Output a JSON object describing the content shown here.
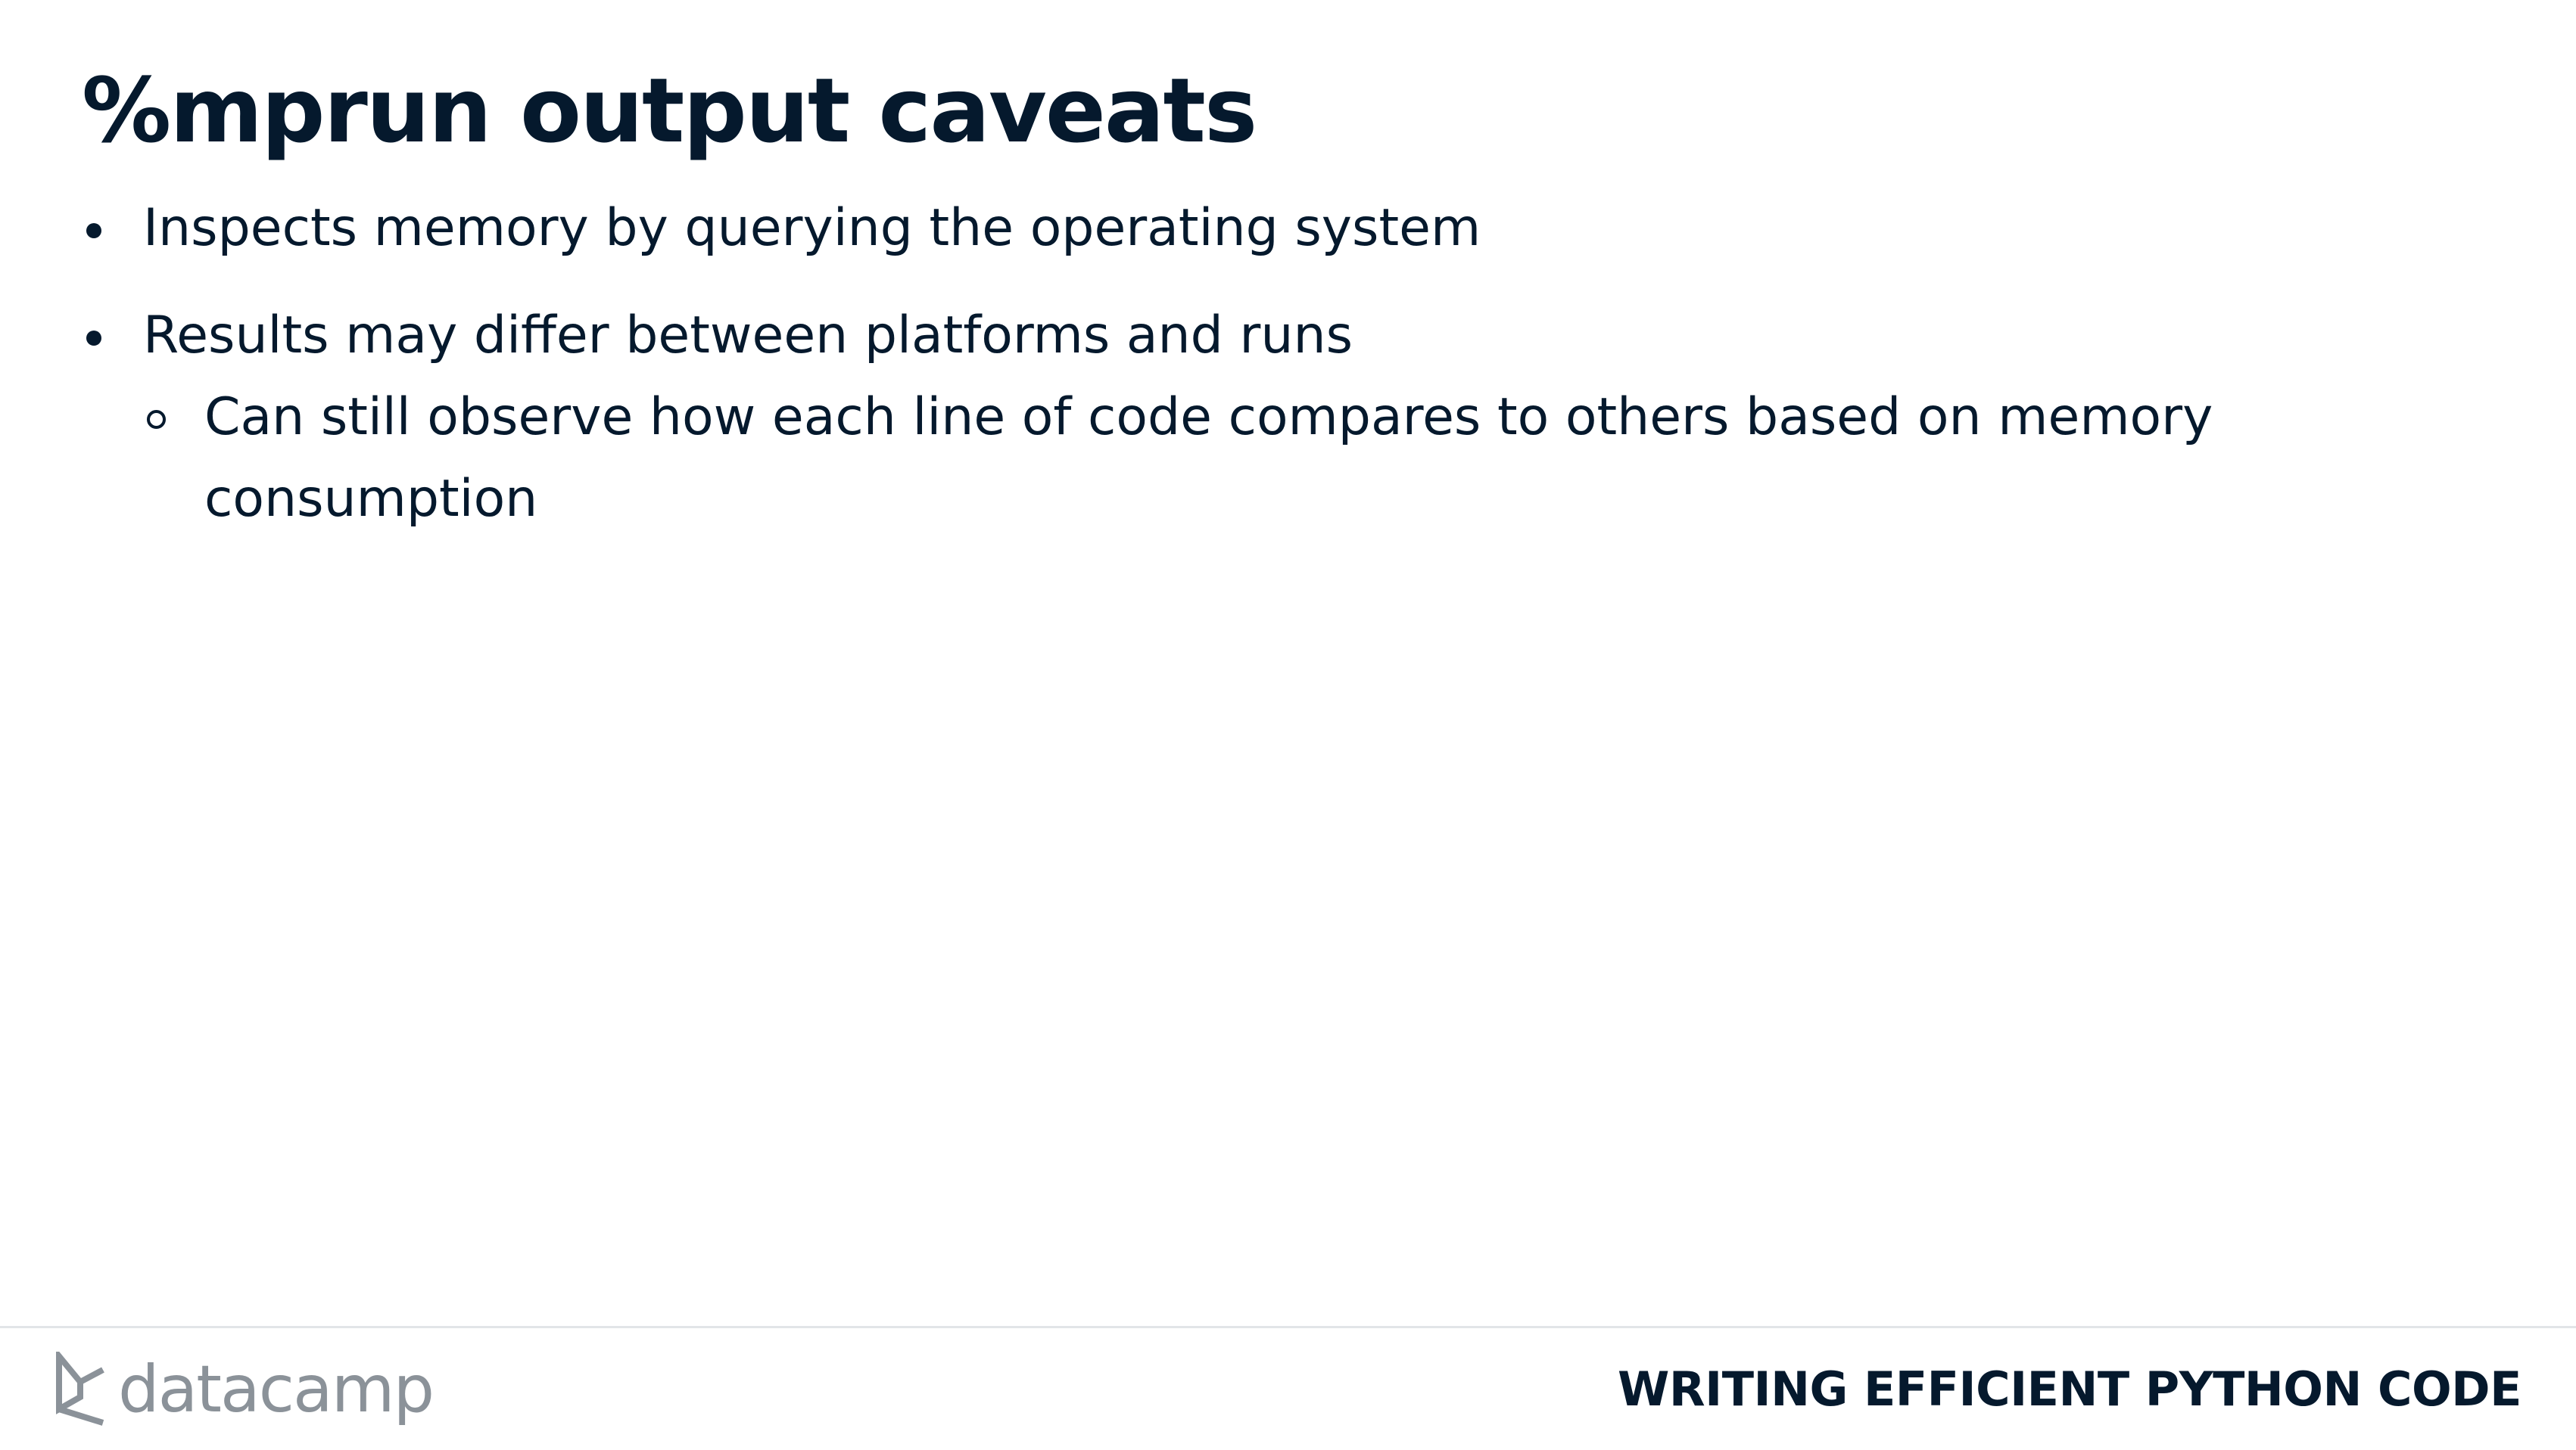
{
  "slide": {
    "title": "%mprun output caveats",
    "bullets": [
      {
        "text": "Inspects memory by querying the operating system",
        "sub": []
      },
      {
        "text": "Results may differ between platforms and runs",
        "sub": [
          "Can still observe how each line of code compares to others based on memory consumption"
        ]
      }
    ]
  },
  "footer": {
    "logo_text": "datacamp",
    "logo_icon": "datacamp-logo-icon",
    "course_name": "WRITING EFFICIENT PYTHON CODE"
  },
  "colors": {
    "text": "#05192D",
    "logo_gray": "#8B9299",
    "divider": "#E2E5E8"
  }
}
